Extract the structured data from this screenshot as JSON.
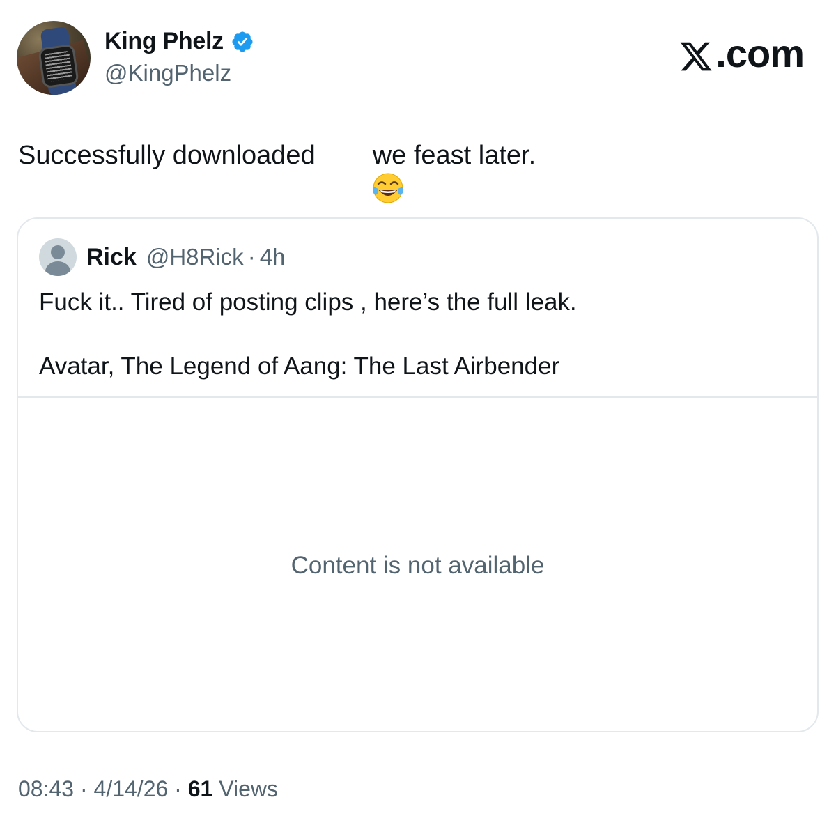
{
  "author": {
    "display_name": "King Phelz",
    "handle": "@KingPhelz",
    "verified": true
  },
  "brand": {
    "text": ".com",
    "logo_icon": "x-logo-icon"
  },
  "tweet": {
    "text_before_emoji": "Successfully downloaded",
    "emoji_icon": "face-with-tears-of-joy-emoji",
    "text_after_emoji": "we feast later."
  },
  "quoted_tweet": {
    "display_name": "Rick",
    "handle": "@H8Rick",
    "separator": "·",
    "time": "4h",
    "line1": "Fuck it.. Tired of posting clips , here’s the full leak.",
    "line2": "Avatar, The Legend of Aang: The Last Airbender",
    "media_message": "Content is not available"
  },
  "meta": {
    "time": "08:43",
    "separator": "·",
    "date": "4/14/26",
    "views_count": "61",
    "views_label": "Views"
  },
  "colors": {
    "text_primary": "#0f1419",
    "text_secondary": "#536471",
    "verified_blue": "#1d9bf0",
    "border": "#e3e8ec"
  }
}
